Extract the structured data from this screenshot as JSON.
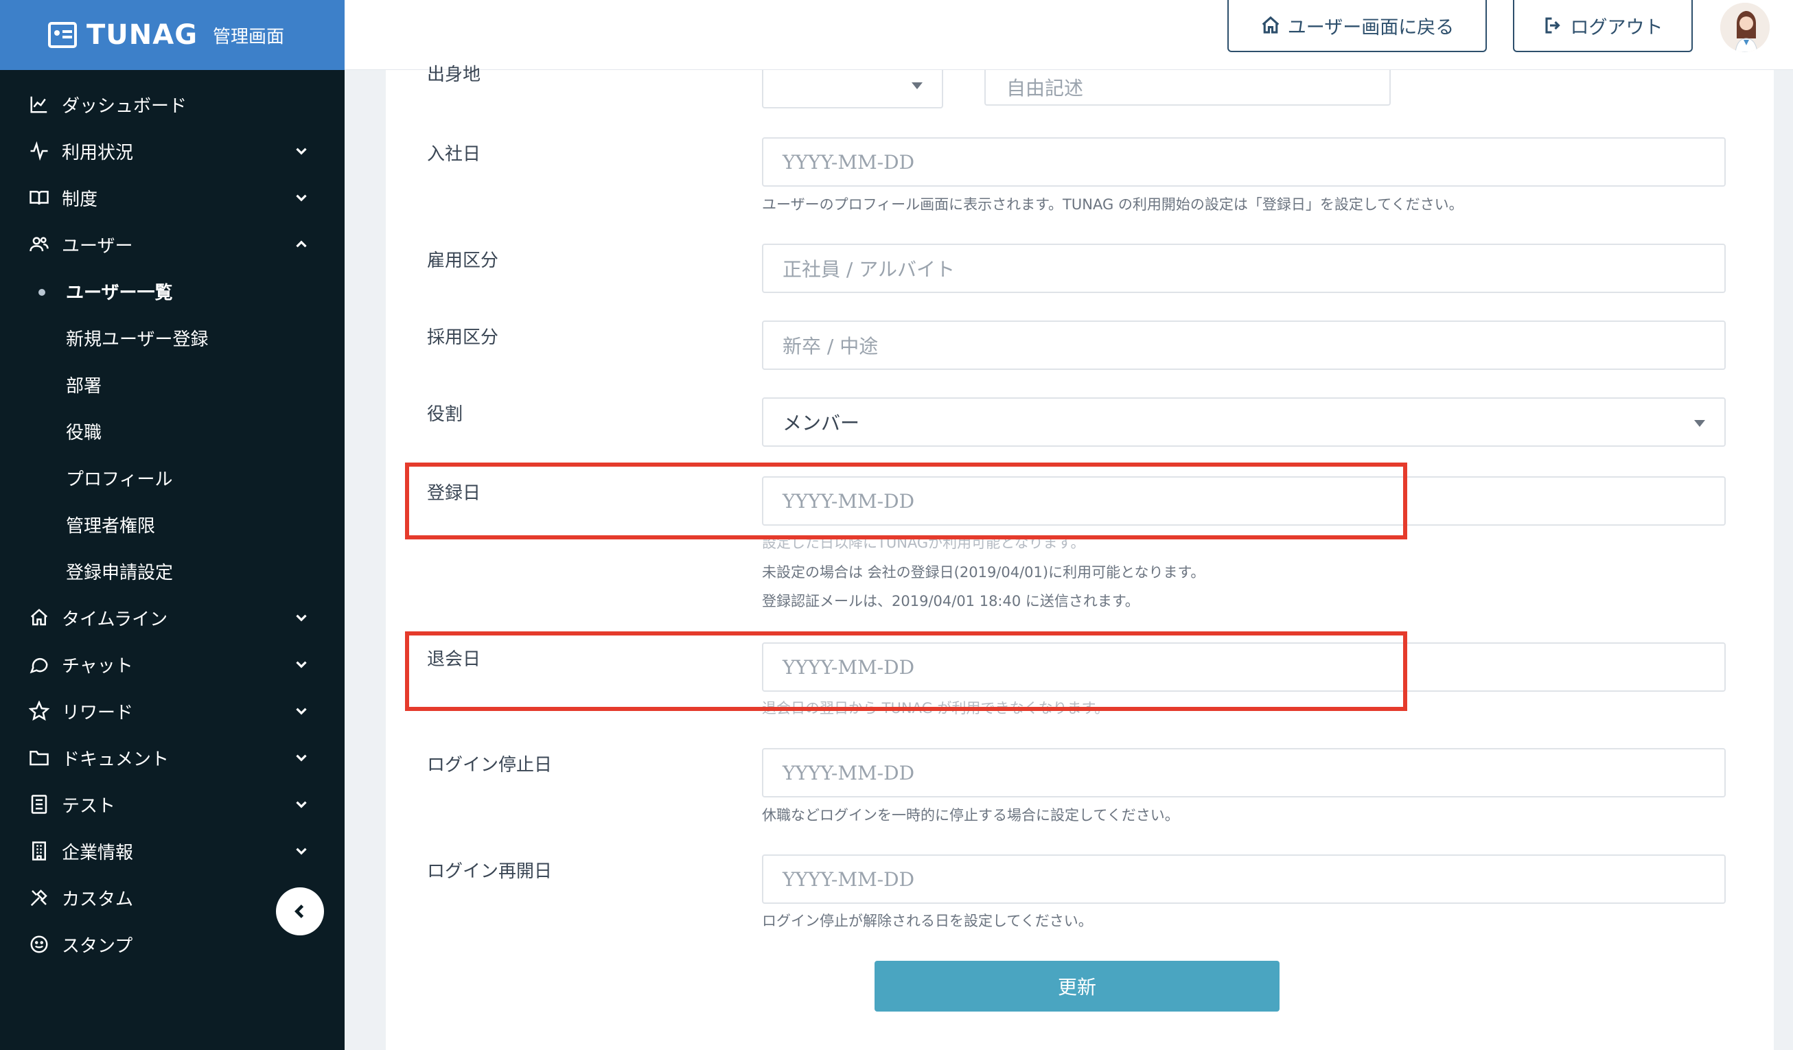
{
  "brand": {
    "name": "TUNAG",
    "subtitle": "管理画面"
  },
  "header": {
    "home_label": "ユーザー画面に戻る",
    "logout_label": "ログアウト"
  },
  "sidebar": {
    "items": [
      {
        "label": "ダッシュボード",
        "icon": "chart-line-icon"
      },
      {
        "label": "利用状況",
        "icon": "activity-icon"
      },
      {
        "label": "制度",
        "icon": "book-icon"
      },
      {
        "label": "ユーザー",
        "icon": "users-icon"
      },
      {
        "label": "タイムライン",
        "icon": "home-icon"
      },
      {
        "label": "チャット",
        "icon": "chat-bubble-icon"
      },
      {
        "label": "リワード",
        "icon": "star-icon"
      },
      {
        "label": "ドキュメント",
        "icon": "folder-icon"
      },
      {
        "label": "テスト",
        "icon": "checklist-icon"
      },
      {
        "label": "企業情報",
        "icon": "building-icon"
      },
      {
        "label": "カスタム",
        "icon": "tools-icon"
      },
      {
        "label": "スタンプ",
        "icon": "smile-icon"
      }
    ],
    "user_sub": [
      {
        "label": "ユーザー一覧"
      },
      {
        "label": "新規ユーザー登録"
      },
      {
        "label": "部署"
      },
      {
        "label": "役職"
      },
      {
        "label": "プロフィール"
      },
      {
        "label": "管理者権限"
      },
      {
        "label": "登録申請設定"
      }
    ]
  },
  "form": {
    "hometown": {
      "label": "出身地",
      "placeholder": "自由記述"
    },
    "join_date": {
      "label": "入社日",
      "placeholder": "YYYY-MM-DD",
      "help": "ユーザーのプロフィール画面に表示されます。TUNAG の利用開始の設定は「登録日」を設定してください。"
    },
    "employment": {
      "label": "雇用区分",
      "placeholder": "正社員 / アルバイト"
    },
    "hiring": {
      "label": "採用区分",
      "placeholder": "新卒 / 中途"
    },
    "role": {
      "label": "役割",
      "value": "メンバー"
    },
    "registration": {
      "label": "登録日",
      "placeholder": "YYYY-MM-DD",
      "help1": "設定した日以降にTUNAGが利用可能となります。",
      "help2": "未設定の場合は 会社の登録日(2019/04/01)に利用可能となります。",
      "help3": "登録認証メールは、2019/04/01 18:40 に送信されます。"
    },
    "withdrawal": {
      "label": "退会日",
      "placeholder": "YYYY-MM-DD",
      "help": "退会日の翌日から TUNAG が利用できなくなります。"
    },
    "login_stop": {
      "label": "ログイン停止日",
      "placeholder": "YYYY-MM-DD",
      "help": "休職などログインを一時的に停止する場合に設定してください。"
    },
    "login_resume": {
      "label": "ログイン再開日",
      "placeholder": "YYYY-MM-DD",
      "help": "ログイン停止が解除される日を設定してください。"
    },
    "submit_label": "更新"
  },
  "colors": {
    "sidebar": "#0b1c24",
    "brand": "#3d80c9",
    "highlight": "#e53b2c",
    "submit": "#4aa5c1"
  }
}
